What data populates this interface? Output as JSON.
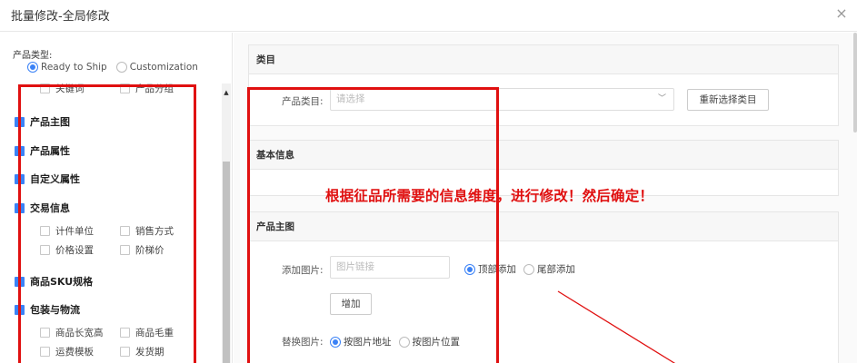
{
  "dialog": {
    "title": "批量修改-全局修改",
    "close_label": "×"
  },
  "left": {
    "product_type_label": "产品类型:",
    "product_type_options": [
      {
        "label": "Ready to Ship",
        "selected": true
      },
      {
        "label": "Customization",
        "selected": false
      }
    ],
    "partial_row": [
      "关键词",
      "产品分组"
    ],
    "groups": [
      {
        "label": "产品主图",
        "children": []
      },
      {
        "label": "产品属性",
        "children": []
      },
      {
        "label": "自定义属性",
        "children": []
      },
      {
        "label": "交易信息",
        "children": [
          [
            "计件单位",
            "销售方式"
          ],
          [
            "价格设置",
            "阶梯价"
          ]
        ]
      },
      {
        "label": "商品SKU规格",
        "children": []
      },
      {
        "label": "包装与物流",
        "children": [
          [
            "商品长宽高",
            "商品毛重"
          ],
          [
            "运费模板",
            "发货期"
          ]
        ]
      }
    ]
  },
  "right": {
    "category_section": {
      "title": "类目",
      "field_label": "产品类目:",
      "select_placeholder": "请选择",
      "reselect_button": "重新选择类目"
    },
    "basic_section": {
      "title": "基本信息"
    },
    "image_section": {
      "title": "产品主图",
      "add_label": "添加图片:",
      "add_placeholder": "图片链接",
      "add_options": [
        {
          "label": "顶部添加",
          "selected": true
        },
        {
          "label": "尾部添加",
          "selected": false
        }
      ],
      "add_button": "增加",
      "replace_label": "替换图片:",
      "replace_options": [
        {
          "label": "按图片地址",
          "selected": true
        },
        {
          "label": "按图片位置",
          "selected": false
        }
      ]
    }
  },
  "annotation": {
    "text": "根据征品所需要的信息维度，进行修改！然后确定！",
    "color": "#e01010"
  },
  "colors": {
    "accent": "#3b82f6",
    "annotation_red": "#e01010"
  }
}
